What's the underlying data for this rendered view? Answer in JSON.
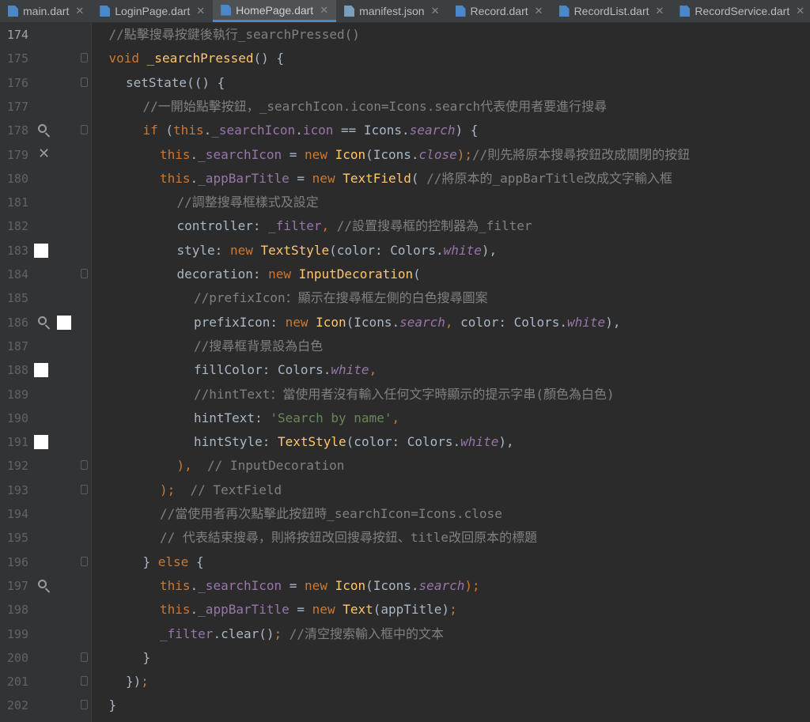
{
  "tabs": [
    {
      "label": "main.dart",
      "active": false,
      "icon": "dart-file-icon"
    },
    {
      "label": "LoginPage.dart",
      "active": false,
      "icon": "dart-file-icon"
    },
    {
      "label": "HomePage.dart",
      "active": true,
      "icon": "dart-file-icon"
    },
    {
      "label": "manifest.json",
      "active": false,
      "icon": "json-file-icon"
    },
    {
      "label": "Record.dart",
      "active": false,
      "icon": "dart-file-icon"
    },
    {
      "label": "RecordList.dart",
      "active": false,
      "icon": "dart-file-icon"
    },
    {
      "label": "RecordService.dart",
      "active": false,
      "icon": "dart-file-icon"
    }
  ],
  "colors": {
    "comment": "#808080",
    "keyword": "#cc7832",
    "field": "#9876aa",
    "class": "#ffc66d",
    "plain": "#a9b7c6",
    "string": "#6a8759",
    "type": "#a9b7c6"
  },
  "lines": [
    {
      "num": "174",
      "gutter": [],
      "fold": false,
      "indent": 1,
      "tokens": [
        [
          "//點擊搜尋按鍵後執行_searchPressed()",
          "comment"
        ]
      ]
    },
    {
      "num": "175",
      "gutter": [],
      "fold": true,
      "indent": 1,
      "tokens": [
        [
          "void ",
          "keyword"
        ],
        [
          "_searchPressed",
          "class"
        ],
        [
          "() {",
          "plain"
        ]
      ]
    },
    {
      "num": "176",
      "gutter": [],
      "fold": true,
      "indent": 2,
      "tokens": [
        [
          "setState",
          "plain"
        ],
        [
          "(() {",
          "plain"
        ]
      ]
    },
    {
      "num": "177",
      "gutter": [],
      "fold": false,
      "indent": 3,
      "tokens": [
        [
          "//一開始點擊按鈕，_searchIcon.icon=Icons.search代表使用者要進行搜尋",
          "comment"
        ]
      ]
    },
    {
      "num": "178",
      "gutter": [
        "magnifier-icon"
      ],
      "fold": true,
      "indent": 3,
      "tokens": [
        [
          "if ",
          "keyword"
        ],
        [
          "(",
          "plain"
        ],
        [
          "this",
          "keyword"
        ],
        [
          ".",
          "plain"
        ],
        [
          "_searchIcon",
          "field"
        ],
        [
          ".",
          "plain"
        ],
        [
          "icon",
          "field"
        ],
        [
          " == Icons.",
          "plain"
        ],
        [
          "search",
          "field"
        ],
        [
          ") {",
          "plain"
        ]
      ]
    },
    {
      "num": "179",
      "gutter": [
        "close-icon"
      ],
      "fold": false,
      "indent": 4,
      "tokens": [
        [
          "this",
          "keyword"
        ],
        [
          ".",
          "plain"
        ],
        [
          "_searchIcon",
          "field"
        ],
        [
          " = ",
          "plain"
        ],
        [
          "new ",
          "keyword"
        ],
        [
          "Icon",
          "class"
        ],
        [
          "(Icons.",
          "plain"
        ],
        [
          "close",
          "field"
        ],
        [
          ");",
          "keyword"
        ],
        [
          "//則先將原本搜尋按鈕改成關閉的按鈕",
          "comment"
        ]
      ]
    },
    {
      "num": "180",
      "gutter": [],
      "fold": false,
      "indent": 4,
      "tokens": [
        [
          "this",
          "keyword"
        ],
        [
          ".",
          "plain"
        ],
        [
          "_appBarTitle",
          "field"
        ],
        [
          " = ",
          "plain"
        ],
        [
          "new ",
          "keyword"
        ],
        [
          "TextField",
          "class"
        ],
        [
          "( ",
          "plain"
        ],
        [
          "//將原本的_appBarTitle改成文字輸入框",
          "comment"
        ]
      ]
    },
    {
      "num": "181",
      "gutter": [],
      "fold": false,
      "indent": 5,
      "tokens": [
        [
          "//調整搜尋框樣式及設定",
          "comment"
        ]
      ]
    },
    {
      "num": "182",
      "gutter": [],
      "fold": false,
      "indent": 5,
      "tokens": [
        [
          "controller: ",
          "plain"
        ],
        [
          "_filter",
          "field"
        ],
        [
          ", ",
          "keyword"
        ],
        [
          "//設置搜尋框的控制器為_filter",
          "comment"
        ]
      ]
    },
    {
      "num": "183",
      "gutter": [
        "white-swatch"
      ],
      "fold": false,
      "indent": 5,
      "tokens": [
        [
          "style: ",
          "plain"
        ],
        [
          "new ",
          "keyword"
        ],
        [
          "TextStyle",
          "class"
        ],
        [
          "(color: Colors.",
          "plain"
        ],
        [
          "white",
          "field"
        ],
        [
          "),",
          "plain"
        ]
      ]
    },
    {
      "num": "184",
      "gutter": [],
      "fold": true,
      "indent": 5,
      "tokens": [
        [
          "decoration: ",
          "plain"
        ],
        [
          "new ",
          "keyword"
        ],
        [
          "InputDecoration",
          "class"
        ],
        [
          "(",
          "plain"
        ]
      ]
    },
    {
      "num": "185",
      "gutter": [],
      "fold": false,
      "indent": 6,
      "tokens": [
        [
          "//prefixIcon：顯示在搜尋框左側的白色搜尋圖案",
          "comment"
        ]
      ]
    },
    {
      "num": "186",
      "gutter": [
        "magnifier-icon",
        "white-swatch"
      ],
      "fold": false,
      "indent": 6,
      "tokens": [
        [
          "prefixIcon: ",
          "plain"
        ],
        [
          "new ",
          "keyword"
        ],
        [
          "Icon",
          "class"
        ],
        [
          "(Icons.",
          "plain"
        ],
        [
          "search",
          "field"
        ],
        [
          ", ",
          "keyword"
        ],
        [
          "color: Colors.",
          "plain"
        ],
        [
          "white",
          "field"
        ],
        [
          "),",
          "plain"
        ]
      ]
    },
    {
      "num": "187",
      "gutter": [],
      "fold": false,
      "indent": 6,
      "tokens": [
        [
          "//搜尋框背景設為白色",
          "comment"
        ]
      ]
    },
    {
      "num": "188",
      "gutter": [
        "white-swatch"
      ],
      "fold": false,
      "indent": 6,
      "tokens": [
        [
          "fillColor: Colors.",
          "plain"
        ],
        [
          "white",
          "field"
        ],
        [
          ",",
          "keyword"
        ]
      ]
    },
    {
      "num": "189",
      "gutter": [],
      "fold": false,
      "indent": 6,
      "tokens": [
        [
          "//hintText：當使用者沒有輸入任何文字時顯示的提示字串(顏色為白色)",
          "comment"
        ]
      ]
    },
    {
      "num": "190",
      "gutter": [],
      "fold": false,
      "indent": 6,
      "tokens": [
        [
          "hintText: ",
          "plain"
        ],
        [
          "'Search by name'",
          "string"
        ],
        [
          ",",
          "keyword"
        ]
      ]
    },
    {
      "num": "191",
      "gutter": [
        "white-swatch"
      ],
      "fold": false,
      "indent": 6,
      "tokens": [
        [
          "hintStyle: ",
          "plain"
        ],
        [
          "TextStyle",
          "class"
        ],
        [
          "(color: Colors.",
          "plain"
        ],
        [
          "white",
          "field"
        ],
        [
          "),",
          "plain"
        ]
      ]
    },
    {
      "num": "192",
      "gutter": [],
      "fold": true,
      "indent": 5,
      "tokens": [
        [
          "),",
          "keyword"
        ],
        [
          "  // InputDecoration",
          "comment"
        ]
      ]
    },
    {
      "num": "193",
      "gutter": [],
      "fold": true,
      "indent": 4,
      "tokens": [
        [
          ");",
          "keyword"
        ],
        [
          "  // TextField",
          "comment"
        ]
      ]
    },
    {
      "num": "194",
      "gutter": [],
      "fold": false,
      "indent": 4,
      "tokens": [
        [
          "//當使用者再次點擊此按鈕時_searchIcon=Icons.close",
          "comment"
        ]
      ]
    },
    {
      "num": "195",
      "gutter": [],
      "fold": false,
      "indent": 4,
      "tokens": [
        [
          "// 代表結束搜尋，則將按鈕改回搜尋按鈕、title改回原本的標題",
          "comment"
        ]
      ]
    },
    {
      "num": "196",
      "gutter": [],
      "fold": true,
      "indent": 3,
      "tokens": [
        [
          "} ",
          "plain"
        ],
        [
          "else ",
          "keyword"
        ],
        [
          "{",
          "plain"
        ]
      ]
    },
    {
      "num": "197",
      "gutter": [
        "magnifier-icon"
      ],
      "fold": false,
      "indent": 4,
      "tokens": [
        [
          "this",
          "keyword"
        ],
        [
          ".",
          "plain"
        ],
        [
          "_searchIcon",
          "field"
        ],
        [
          " = ",
          "plain"
        ],
        [
          "new ",
          "keyword"
        ],
        [
          "Icon",
          "class"
        ],
        [
          "(Icons.",
          "plain"
        ],
        [
          "search",
          "field"
        ],
        [
          ");",
          "keyword"
        ]
      ]
    },
    {
      "num": "198",
      "gutter": [],
      "fold": false,
      "indent": 4,
      "tokens": [
        [
          "this",
          "keyword"
        ],
        [
          ".",
          "plain"
        ],
        [
          "_appBarTitle",
          "field"
        ],
        [
          " = ",
          "plain"
        ],
        [
          "new ",
          "keyword"
        ],
        [
          "Text",
          "class"
        ],
        [
          "(appTitle)",
          "plain"
        ],
        [
          ";",
          "keyword"
        ]
      ]
    },
    {
      "num": "199",
      "gutter": [],
      "fold": false,
      "indent": 4,
      "tokens": [
        [
          "_filter",
          "field"
        ],
        [
          ".clear()",
          "plain"
        ],
        [
          "; ",
          "keyword"
        ],
        [
          "//清空搜索輸入框中的文本",
          "comment"
        ]
      ]
    },
    {
      "num": "200",
      "gutter": [],
      "fold": true,
      "indent": 3,
      "tokens": [
        [
          "}",
          "plain"
        ]
      ]
    },
    {
      "num": "201",
      "gutter": [],
      "fold": true,
      "indent": 2,
      "tokens": [
        [
          "})",
          "plain"
        ],
        [
          ";",
          "keyword"
        ]
      ]
    },
    {
      "num": "202",
      "gutter": [],
      "fold": true,
      "indent": 1,
      "tokens": [
        [
          "}",
          "plain"
        ]
      ]
    }
  ]
}
